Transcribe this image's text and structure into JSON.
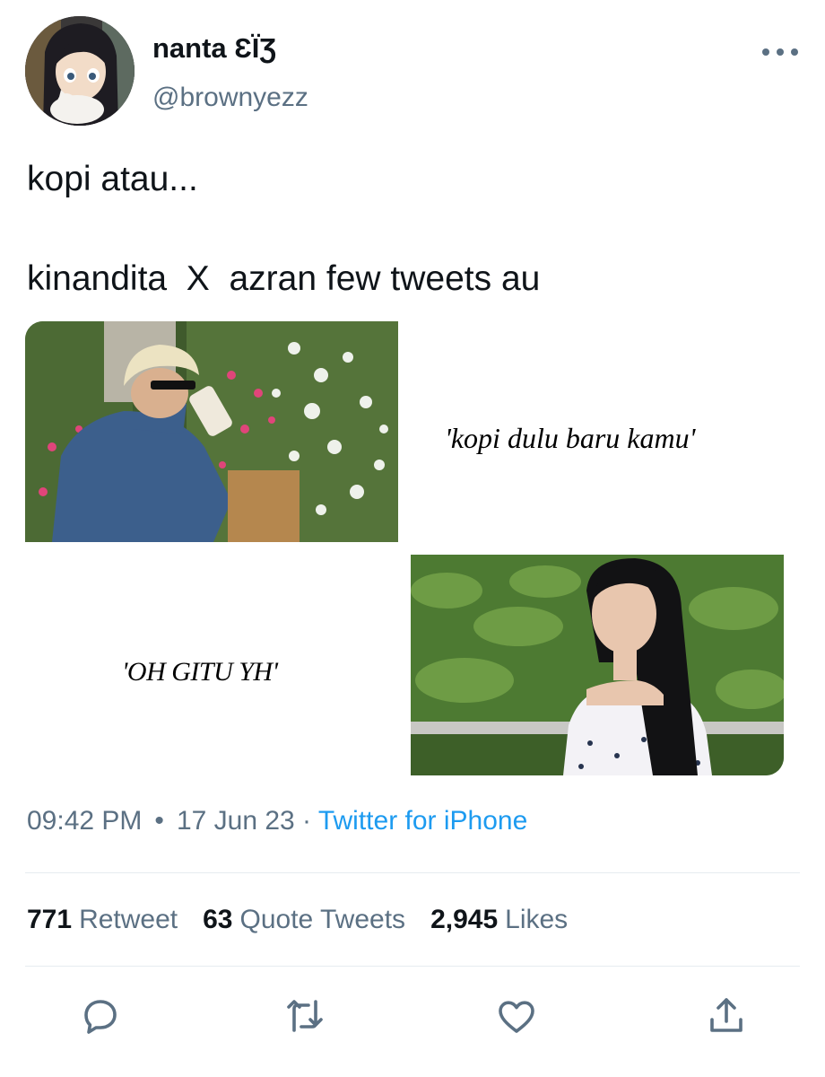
{
  "user": {
    "display_name": "nanta ƐЇƷ",
    "handle": "@brownyezz"
  },
  "tweet": {
    "line1": "kopi atau...",
    "line2": "kinandita  X  azran few tweets au"
  },
  "media": {
    "caption_1": "'kopi dulu baru kamu'",
    "caption_2": "'OH GITU YH'"
  },
  "meta": {
    "time": "09:42 PM",
    "date": "17 Jun 23",
    "source": "Twitter for iPhone"
  },
  "stats": {
    "retweets_count": "771",
    "retweets_label": "Retweet",
    "quotes_count": "63",
    "quotes_label": "Quote Tweets",
    "likes_count": "2,945",
    "likes_label": "Likes"
  },
  "icons": {
    "more": "more-horizontal-icon",
    "reply": "reply-icon",
    "retweet": "retweet-icon",
    "like": "heart-icon",
    "share": "share-icon"
  },
  "colors": {
    "accent": "#1d9bf0",
    "secondary_text": "#5b7083",
    "primary_text": "#0f1419"
  }
}
